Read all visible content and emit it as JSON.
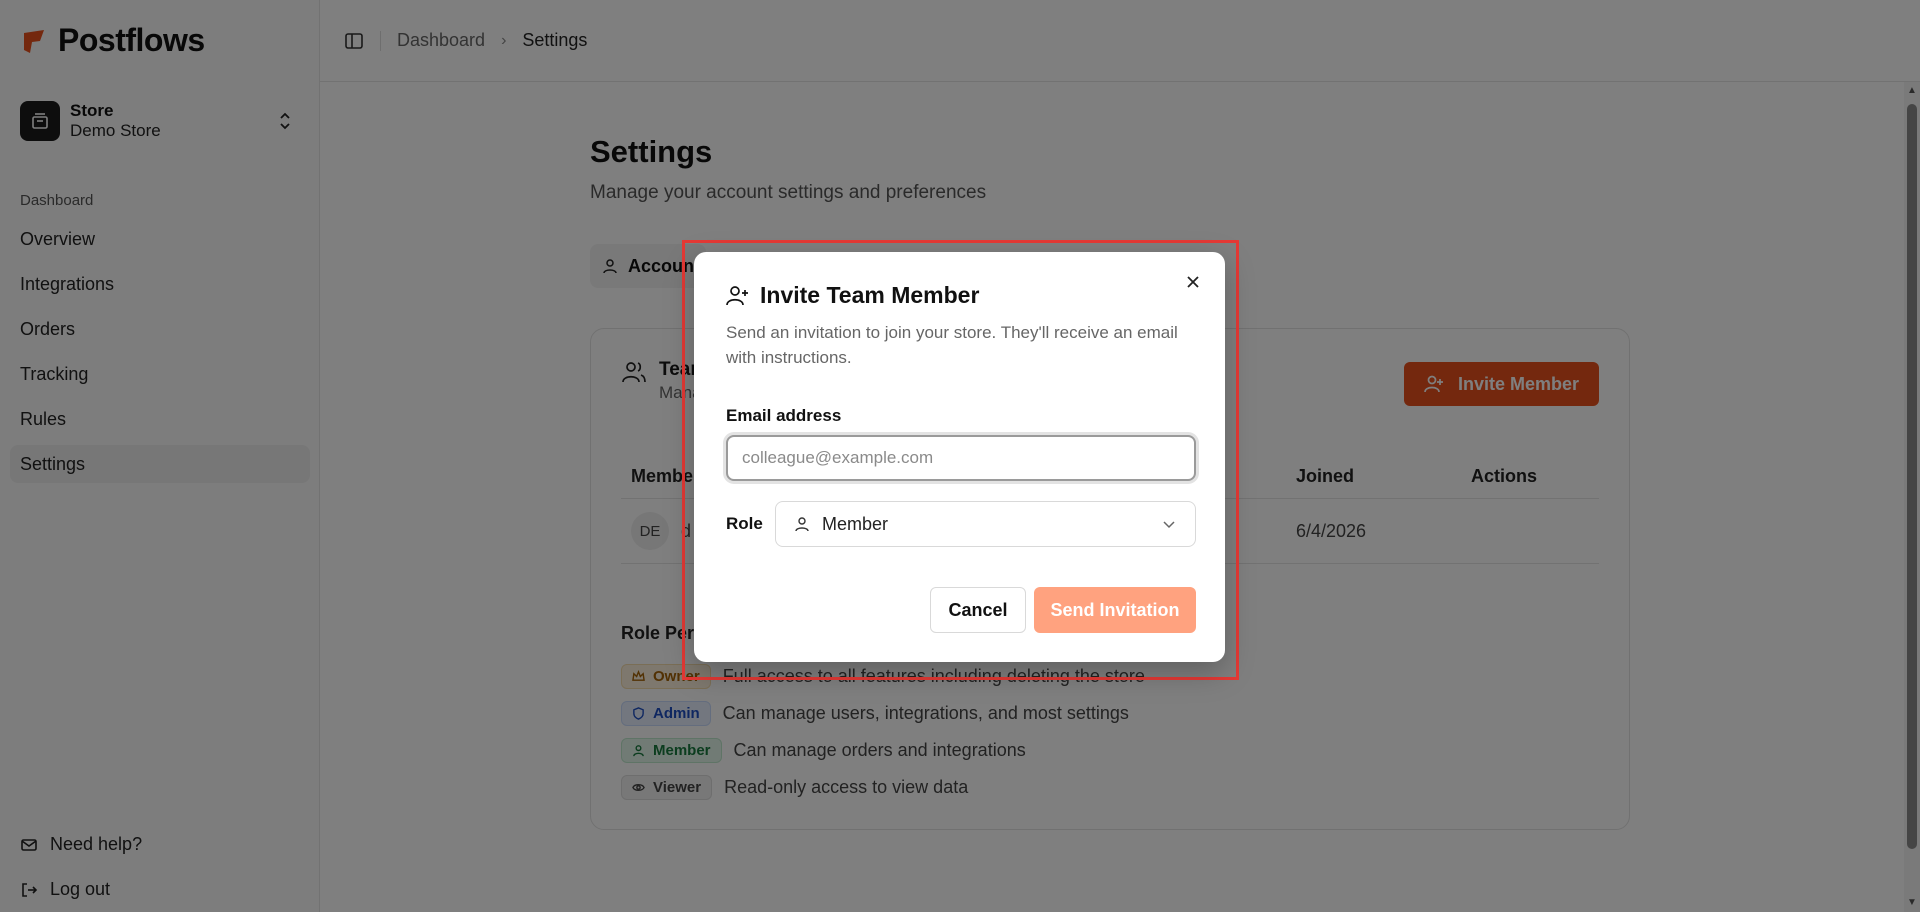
{
  "app": {
    "brand_name": "Postflows",
    "brand_color": "#e8501c"
  },
  "store": {
    "label": "Store",
    "name": "Demo Store"
  },
  "sidebar": {
    "group_label": "Dashboard",
    "items": [
      {
        "label": "Overview"
      },
      {
        "label": "Integrations"
      },
      {
        "label": "Orders"
      },
      {
        "label": "Tracking"
      },
      {
        "label": "Rules"
      },
      {
        "label": "Settings",
        "active": true
      }
    ],
    "bottom": {
      "help": "Need help?",
      "logout": "Log out"
    }
  },
  "breadcrumb": {
    "root": "Dashboard",
    "current": "Settings"
  },
  "page": {
    "title": "Settings",
    "subtitle": "Manage your account settings and preferences",
    "tab_account": "Accoun"
  },
  "team": {
    "title": "Tean",
    "desc": "Mana",
    "invite_button": "Invite Member",
    "columns": {
      "member": "Member",
      "joined": "Joined",
      "actions": "Actions"
    },
    "rows": [
      {
        "initials": "DE",
        "name": "d",
        "joined": "6/4/2026"
      }
    ]
  },
  "roles": {
    "title": "Role Perm",
    "items": [
      {
        "name": "Owner",
        "desc": "Full access to all features including deleting the store"
      },
      {
        "name": "Admin",
        "desc": "Can manage users, integrations, and most settings"
      },
      {
        "name": "Member",
        "desc": "Can manage orders and integrations"
      },
      {
        "name": "Viewer",
        "desc": "Read-only access to view data"
      }
    ]
  },
  "dialog": {
    "title": "Invite Team Member",
    "description": "Send an invitation to join your store. They'll receive an email with instructions.",
    "email_label": "Email address",
    "email_placeholder": "colleague@example.com",
    "email_value": "",
    "role_label": "Role",
    "role_value": "Member",
    "cancel": "Cancel",
    "send": "Send Invitation"
  }
}
